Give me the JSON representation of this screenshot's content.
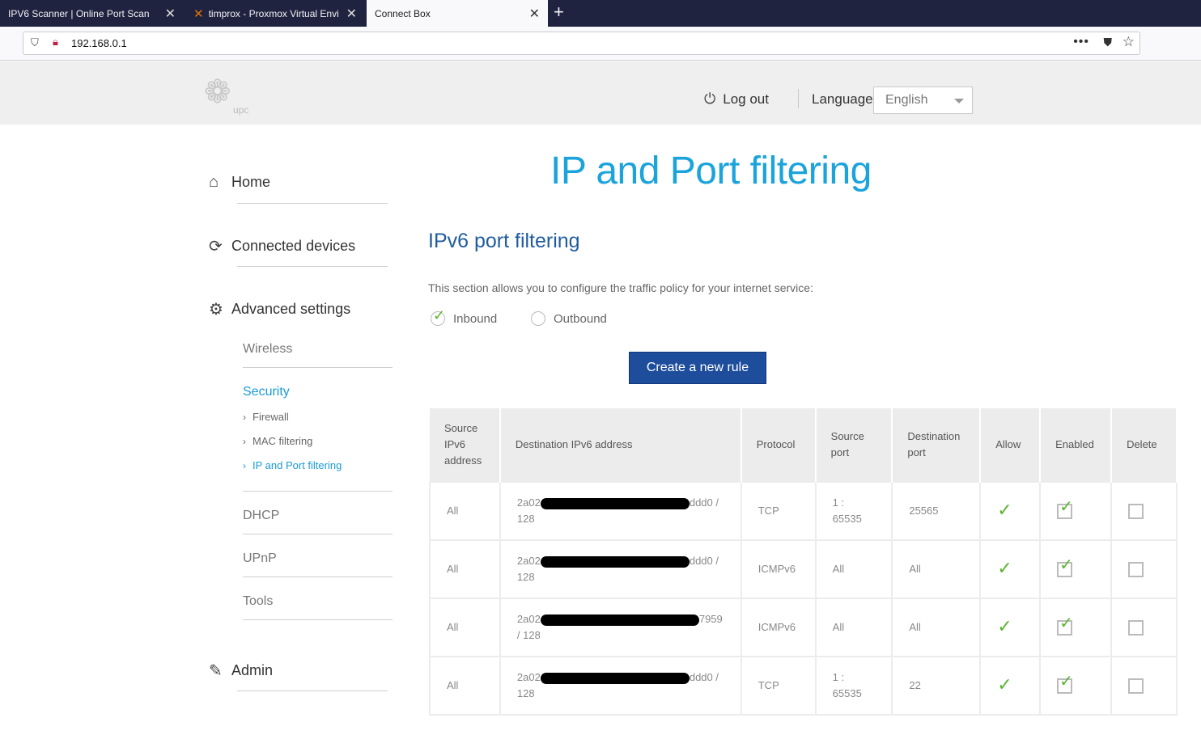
{
  "browser": {
    "tabs": [
      {
        "label": "IPV6 Scanner | Online Port Scan",
        "active": false
      },
      {
        "label": "timprox - Proxmox Virtual Envi",
        "active": false
      },
      {
        "label": "Connect Box",
        "active": true
      }
    ],
    "url": "192.168.0.1"
  },
  "header": {
    "logo_text": "upc",
    "logout_label": "Log out",
    "language_label": "Language",
    "language_value": "English"
  },
  "sidebar": {
    "home": "Home",
    "connected_devices": "Connected devices",
    "advanced_settings": "Advanced settings",
    "wireless": "Wireless",
    "security": "Security",
    "firewall": "Firewall",
    "mac_filtering": "MAC filtering",
    "ip_port_filtering": "IP and Port filtering",
    "dhcp": "DHCP",
    "upnp": "UPnP",
    "tools": "Tools",
    "admin": "Admin"
  },
  "main": {
    "title": "IP and Port filtering",
    "section_title": "IPv6 port filtering",
    "description": "This section allows you to configure the traffic policy for your internet service:",
    "inbound_label": "Inbound",
    "outbound_label": "Outbound",
    "create_button": "Create a new rule"
  },
  "table": {
    "headers": {
      "source": "Source IPv6 address",
      "destination": "Destination IPv6 address",
      "protocol": "Protocol",
      "source_port": "Source port",
      "destination_port": "Destination port",
      "allow": "Allow",
      "enabled": "Enabled",
      "delete": "Delete"
    },
    "rows": [
      {
        "source": "All",
        "dest_prefix": "2a02",
        "dest_suffix": "ddd0 /",
        "dest_line2": "128",
        "protocol": "TCP",
        "source_port": "1 : 65535",
        "dest_port": "25565"
      },
      {
        "source": "All",
        "dest_prefix": "2a02",
        "dest_suffix": "ddd0 /",
        "dest_line2": "128",
        "protocol": "ICMPv6",
        "source_port": "All",
        "dest_port": "All"
      },
      {
        "source": "All",
        "dest_prefix": "2a02",
        "dest_suffix": "7959",
        "dest_line2": "/ 128",
        "protocol": "ICMPv6",
        "source_port": "All",
        "dest_port": "All"
      },
      {
        "source": "All",
        "dest_prefix": "2a02",
        "dest_suffix": "ddd0 /",
        "dest_line2": "128",
        "protocol": "TCP",
        "source_port": "1 : 65535",
        "dest_port": "22"
      }
    ]
  }
}
